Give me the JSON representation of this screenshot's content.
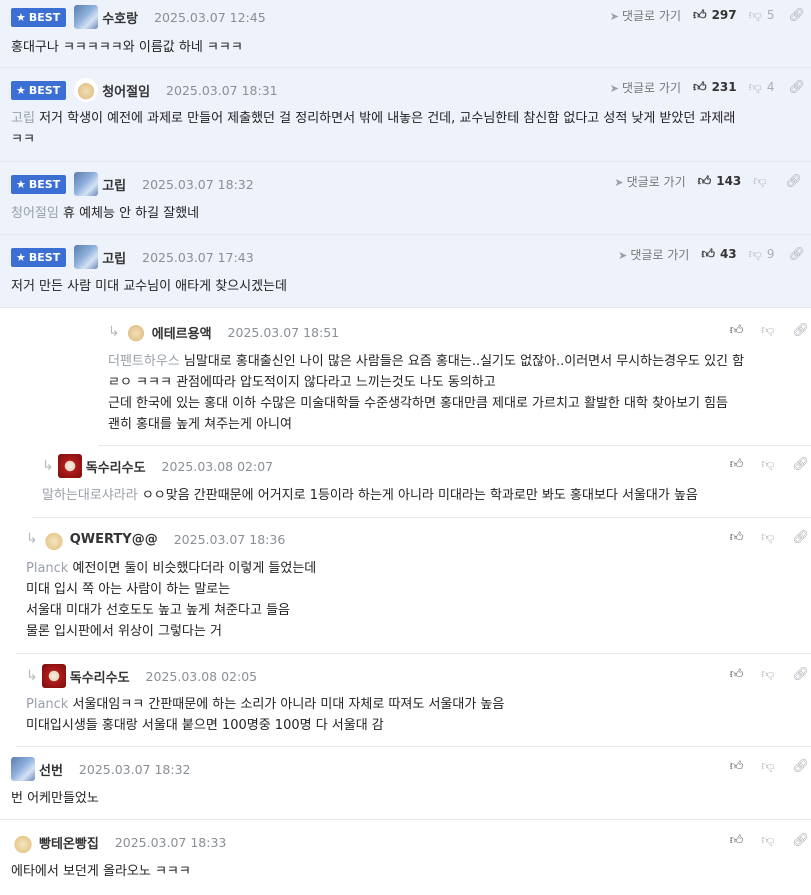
{
  "best_label": "BEST",
  "reply_to_label": "댓글로 가기",
  "comments": [
    {
      "nick": "수호랑",
      "date": "2025.03.07 12:45",
      "likes": "297",
      "dislikes": "5",
      "mention": "",
      "lines": [
        "홍대구나 ㅋㅋㅋㅋㅋ와 이름값 하네 ㅋㅋㅋ"
      ]
    },
    {
      "nick": "청어절임",
      "date": "2025.03.07 18:31",
      "likes": "231",
      "dislikes": "4",
      "mention": "고립",
      "lines": [
        "저거 학생이 예전에 과제로 만들어 제출했던 걸 정리하면서 밖에 내놓은 건데, 교수님한테 참신함 없다고 성적 낮게 받았던 과제래",
        "ㅋㅋ"
      ]
    },
    {
      "nick": "고립",
      "date": "2025.03.07 18:32",
      "likes": "143",
      "dislikes": "",
      "mention": "청어절임",
      "lines": [
        "휴 예체능 안 하길 잘했네"
      ]
    },
    {
      "nick": "고립",
      "date": "2025.03.07 17:43",
      "likes": "43",
      "dislikes": "9",
      "mention": "",
      "lines": [
        "저거 만든 사람 미대 교수님이 애타게 찾으시겠는데"
      ]
    },
    {
      "nick": "에테르용액",
      "date": "2025.03.07 18:51",
      "mention": "더펜트하우스",
      "lines": [
        "님말대로 홍대출신인 나이 많은 사람들은 요즘 홍대는..실기도 없잖아..이러면서 무시하는경우도 있긴 함",
        "ㄹㅇ ㅋㅋㅋ 관점에따라 압도적이지 않다라고 느끼는것도 나도 동의하고",
        "근데 한국에 있는 홍대 이하 수많은 미술대학들 수준생각하면 홍대만큼 제대로 가르치고 활발한 대학 찾아보기 힘듬",
        "괜히 홍대를 높게 쳐주는게 아니여"
      ]
    },
    {
      "nick": "독수리수도",
      "date": "2025.03.08 02:07",
      "mention": "말하는대로샤라라",
      "lines": [
        "ㅇㅇ맞음 간판때문에 어거지로 1등이라 하는게 아니라 미대라는 학과로만 봐도 홍대보다 서울대가 높음"
      ]
    },
    {
      "nick": "QWERTY@@",
      "date": "2025.03.07 18:36",
      "mention": "Planck",
      "lines": [
        "예전이면 둘이 비슷했다더라 이렇게 들었는데",
        "미대 입시 쪽 아는 사람이 하는 말로는",
        "서울대 미대가 선호도도 높고 높게 쳐준다고 들음",
        "물론 입시판에서 위상이 그렇다는 거"
      ]
    },
    {
      "nick": "독수리수도",
      "date": "2025.03.08 02:05",
      "mention": "Planck",
      "lines": [
        "서울대임ㅋㅋ 간판때문에 하는 소리가 아니라 미대 자체로 따져도 서울대가 높음",
        "미대입시생들 홍대랑 서울대 붙으면 100명중 100명 다 서울대 감"
      ]
    },
    {
      "nick": "선번",
      "date": "2025.03.07 18:32",
      "mention": "",
      "lines": [
        "번 어케만들었노"
      ]
    },
    {
      "nick": "빵테온빵집",
      "date": "2025.03.07 18:33",
      "mention": "",
      "lines": [
        "에타에서 보던게 올라오노 ㅋㅋㅋ"
      ]
    }
  ],
  "icons": {
    "reply": "send-icon",
    "like": "thumbs-up-icon",
    "dislike": "thumbs-down-icon",
    "share": "link-icon",
    "reply_arrow": "reply-arrow-icon",
    "best": "star-icon"
  },
  "colors": {
    "best_badge": "#3b6fd4",
    "best_background": "#eef2fb",
    "mention": "#9aa0a8"
  }
}
